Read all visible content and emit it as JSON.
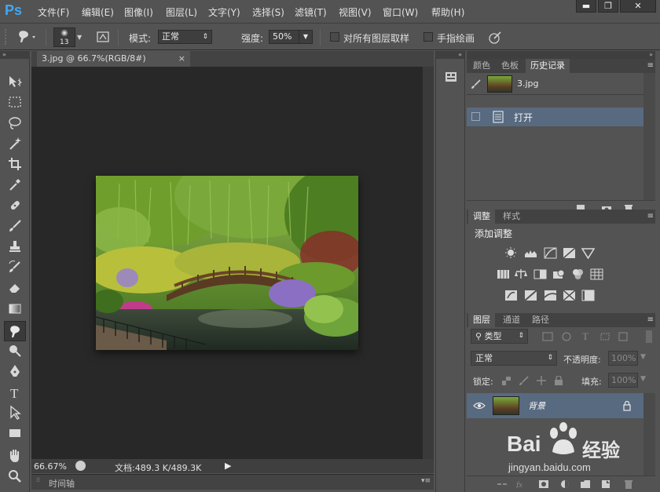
{
  "app": {
    "logo": "Ps"
  },
  "menu": [
    "文件(F)",
    "编辑(E)",
    "图像(I)",
    "图层(L)",
    "文字(Y)",
    "选择(S)",
    "滤镜(T)",
    "视图(V)",
    "窗口(W)",
    "帮助(H)"
  ],
  "window_controls": {
    "minimize": "▬",
    "restore": "❐",
    "close": "✕"
  },
  "options": {
    "brush_size": "13",
    "mode_label": "模式:",
    "mode_value": "正常",
    "strength_label": "强度:",
    "strength_value": "50%",
    "sample_all_label": "对所有图层取样",
    "finger_paint_label": "手指绘画"
  },
  "document": {
    "tab_title": "3.jpg @ 66.7%(RGB/8#)",
    "tab_close": "×",
    "zoom": "66.67%",
    "doc_info": "文档:489.3 K/489.3K",
    "timeline_label": "时间轴"
  },
  "history_panel": {
    "tabs": [
      "颜色",
      "色板",
      "历史记录"
    ],
    "active_tab": "历史记录",
    "snapshot_name": "3.jpg",
    "entries": [
      "打开"
    ]
  },
  "adjustments_panel": {
    "tabs": [
      "调整",
      "样式"
    ],
    "active_tab": "调整",
    "title": "添加调整"
  },
  "layers_panel": {
    "tabs": [
      "图层",
      "通道",
      "路径"
    ],
    "active_tab": "图层",
    "filter_label": "类型",
    "blend_mode": "正常",
    "opacity_label": "不透明度:",
    "opacity_value": "100%",
    "lock_label": "锁定:",
    "fill_label": "填充:",
    "fill_value": "100%",
    "layers": [
      {
        "name": "背景",
        "visible": true,
        "locked": true
      }
    ]
  },
  "watermark": {
    "brand": "Bai",
    "cn": "经验",
    "url": "jingyan.baidu.com"
  },
  "colors": {
    "panel_bg": "#535353",
    "canvas_bg": "#282828",
    "selected_row": "#586a80",
    "ps_blue": "#3fa9f5"
  }
}
